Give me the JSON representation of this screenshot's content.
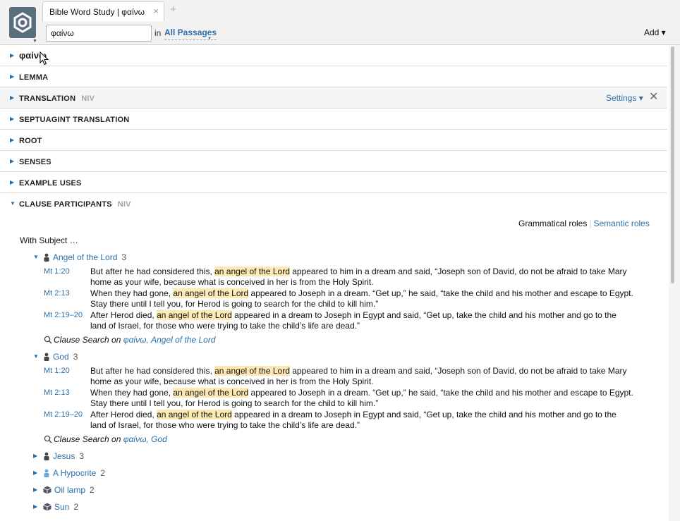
{
  "tab": {
    "title": "Bible Word Study | φαίνω",
    "close": "×",
    "add": "+"
  },
  "search": {
    "value": "φαίνω",
    "placeholder": "",
    "in_label": "in",
    "passages": "All Passages"
  },
  "toolbar": {
    "add_label": "Add ▾"
  },
  "sections": [
    {
      "label": "φαίνω",
      "sub": ""
    },
    {
      "label": "LEMMA",
      "sub": ""
    },
    {
      "label": "TRANSLATION",
      "sub": "NIV",
      "settings": "Settings ▾",
      "close": "✕"
    },
    {
      "label": "SEPTUAGINT TRANSLATION",
      "sub": ""
    },
    {
      "label": "ROOT",
      "sub": ""
    },
    {
      "label": "SENSES",
      "sub": ""
    },
    {
      "label": "EXAMPLE USES",
      "sub": ""
    },
    {
      "label": "CLAUSE PARTICIPANTS",
      "sub": "NIV"
    }
  ],
  "roles": {
    "grammatical": "Grammatical roles",
    "semantic": "Semantic roles"
  },
  "with_subject": "With Subject …",
  "participants": [
    {
      "name": "Angel of the Lord",
      "count": "3"
    },
    {
      "name": "God",
      "count": "3"
    },
    {
      "name": "Jesus",
      "count": "3"
    },
    {
      "name": "A Hypocrite",
      "count": "2"
    },
    {
      "name": "Oil lamp",
      "count": "2"
    },
    {
      "name": "Sun",
      "count": "2"
    }
  ],
  "verses": [
    {
      "ref": "Mt 1:20",
      "pre": "But after he had considered this, ",
      "hl": "an angel of the Lord",
      "post": " appeared to him in a dream and said, “Joseph son of David, do not be afraid to take Mary home as your wife, because what is conceived in her is from the Holy Spirit."
    },
    {
      "ref": "Mt 2:13",
      "pre": "When they had gone, ",
      "hl": "an angel of the Lord",
      "post": " appeared to Joseph in a dream. “Get up,” he said, “take the child and his mother and escape to Egypt. Stay there until I tell you, for Herod is going to search for the child to kill him.”"
    },
    {
      "ref": "Mt 2:19–20",
      "pre": "After Herod died, ",
      "hl": "an angel of the Lord",
      "post": " appeared in a dream to Joseph in Egypt and said, “Get up, take the child and his mother and go to the land of Israel, for those who were trying to take the child’s life are dead.”"
    }
  ],
  "clause_search": {
    "label": "Clause Search on ",
    "angel": "φαίνω, Angel of the Lord",
    "god": "φαίνω, God"
  },
  "colors": {
    "accent": "#2a6fa8",
    "highlight": "#fde9b3",
    "logo": "#5a6f7e"
  }
}
